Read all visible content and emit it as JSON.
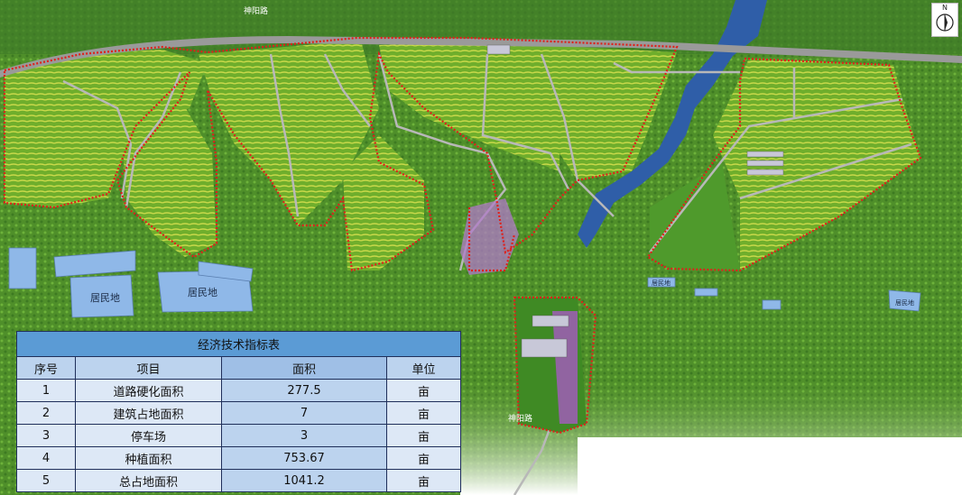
{
  "map": {
    "road_label_top": "神阳路",
    "road_label_bottom": "神阳路",
    "residential_labels": [
      "居民地",
      "居民地"
    ],
    "residential_small_labels": [
      "居民地",
      "居民地"
    ],
    "compass_letter": "N",
    "colors": {
      "boundary": "#e0201a",
      "road": "#9a9a9a",
      "water": "#2f5ea8",
      "residential": "#8fb8e8",
      "vegetation": "#5c9a2e"
    }
  },
  "table": {
    "title": "经济技术指标表",
    "headers": [
      "序号",
      "项目",
      "面积",
      "单位"
    ],
    "rows": [
      {
        "no": "1",
        "item": "道路硬化面积",
        "area": "277.5",
        "unit": "亩"
      },
      {
        "no": "2",
        "item": "建筑占地面积",
        "area": "7",
        "unit": "亩"
      },
      {
        "no": "3",
        "item": "停车场",
        "area": "3",
        "unit": "亩"
      },
      {
        "no": "4",
        "item": "种植面积",
        "area": "753.67",
        "unit": "亩"
      },
      {
        "no": "5",
        "item": "总占地面积",
        "area": "1041.2",
        "unit": "亩"
      }
    ]
  }
}
